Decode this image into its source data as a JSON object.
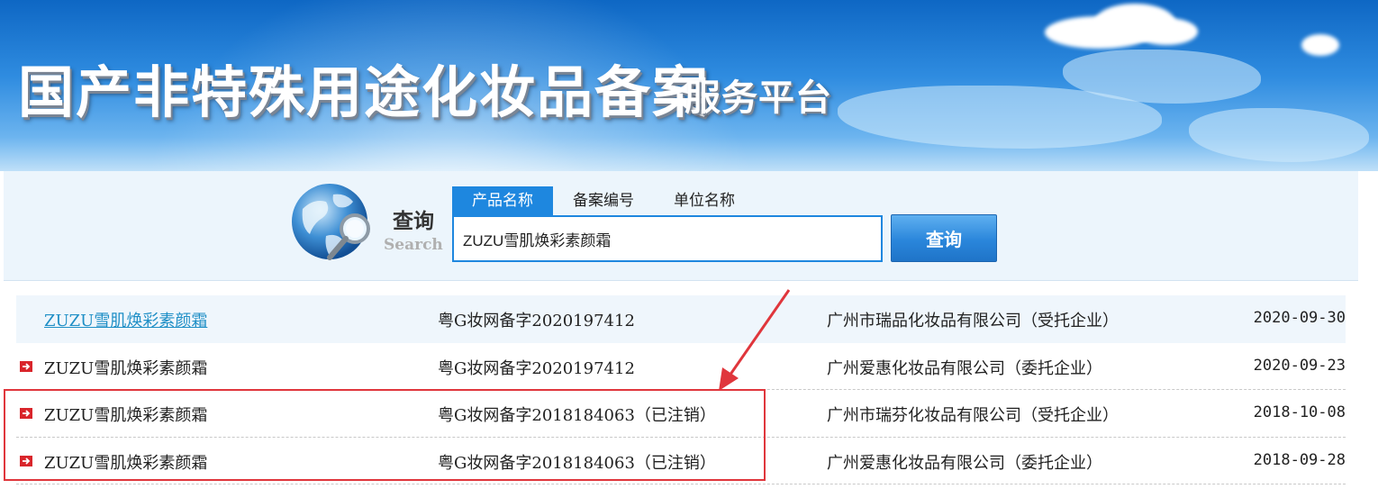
{
  "banner": {
    "title": "国产非特殊用途化妆品备案",
    "subtitle": "服务平台"
  },
  "search": {
    "caption_cn": "查询",
    "caption_en": "Search",
    "tabs": [
      {
        "label": "产品名称",
        "active": true
      },
      {
        "label": "备案编号",
        "active": false
      },
      {
        "label": "单位名称",
        "active": false
      }
    ],
    "query": "ZUZU雪肌焕彩素颜霜",
    "button_label": "查询"
  },
  "results": [
    {
      "name": "ZUZU雪肌焕彩素颜霜",
      "number": "粤G妆网备字2020197412",
      "company": "广州市瑞品化妆品有限公司（受托企业）",
      "date": "2020-09-30",
      "icon": "arrow-right-icon"
    },
    {
      "name": "ZUZU雪肌焕彩素颜霜",
      "number": "粤G妆网备字2020197412",
      "company": "广州爱惠化妆品有限公司（委托企业）",
      "date": "2020-09-23",
      "icon": "arrow-right-icon"
    },
    {
      "name": "ZUZU雪肌焕彩素颜霜",
      "number": "粤G妆网备字2018184063（已注销）",
      "company": "广州市瑞芬化妆品有限公司（受托企业）",
      "date": "2018-10-08",
      "icon": "arrow-right-icon"
    },
    {
      "name": "ZUZU雪肌焕彩素颜霜",
      "number": "粤G妆网备字2018184063（已注销）",
      "company": "广州爱惠化妆品有限公司（委托企业）",
      "date": "2018-09-28",
      "icon": "arrow-right-icon"
    }
  ],
  "colors": {
    "accent": "#1e87df",
    "link": "#1f8fc6",
    "annotation": "#e0363c"
  }
}
